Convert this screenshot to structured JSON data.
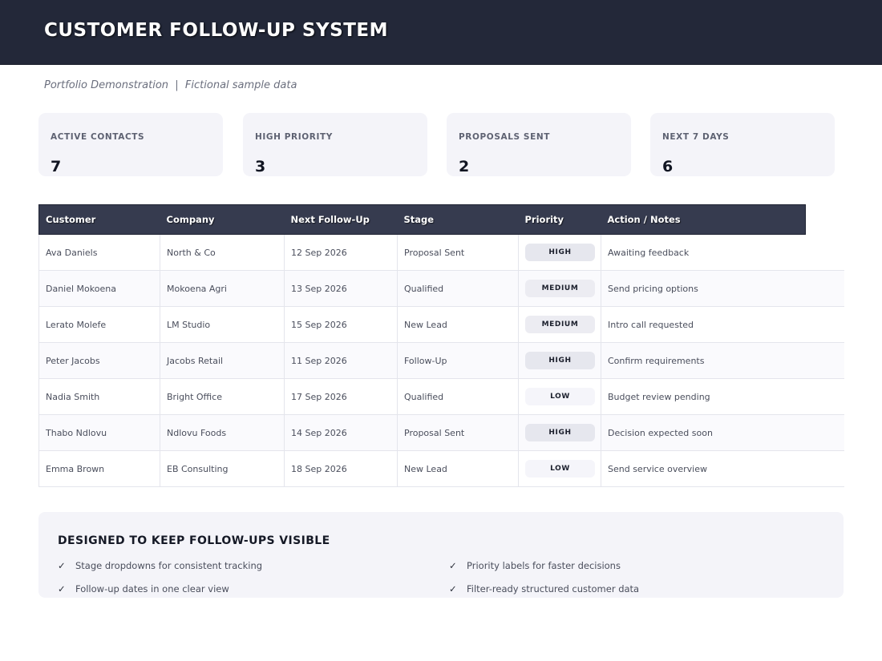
{
  "header": {
    "title": "CUSTOMER FOLLOW-UP SYSTEM"
  },
  "subtitle": "Portfolio Demonstration  |  Fictional sample data",
  "kpis": [
    {
      "label": "ACTIVE CONTACTS",
      "value": "7"
    },
    {
      "label": "HIGH PRIORITY",
      "value": "3"
    },
    {
      "label": "PROPOSALS SENT",
      "value": "2"
    },
    {
      "label": "NEXT 7 DAYS",
      "value": "6"
    }
  ],
  "table": {
    "columns": [
      "Customer",
      "Company",
      "Next Follow-Up",
      "Stage",
      "Priority",
      "Action / Notes"
    ],
    "rows": [
      [
        "Ava Daniels",
        "North & Co",
        "12 Sep 2026",
        "Proposal Sent",
        "HIGH",
        "Awaiting feedback"
      ],
      [
        "Daniel Mokoena",
        "Mokoena Agri",
        "13 Sep 2026",
        "Qualified",
        "MEDIUM",
        "Send pricing options"
      ],
      [
        "Lerato Molefe",
        "LM Studio",
        "15 Sep 2026",
        "New Lead",
        "MEDIUM",
        "Intro call requested"
      ],
      [
        "Peter Jacobs",
        "Jacobs Retail",
        "11 Sep 2026",
        "Follow-Up",
        "HIGH",
        "Confirm requirements"
      ],
      [
        "Nadia Smith",
        "Bright Office",
        "17 Sep 2026",
        "Qualified",
        "LOW",
        "Budget review pending"
      ],
      [
        "Thabo Ndlovu",
        "Ndlovu Foods",
        "14 Sep 2026",
        "Proposal Sent",
        "HIGH",
        "Decision expected soon"
      ],
      [
        "Emma Brown",
        "EB Consulting",
        "18 Sep 2026",
        "New Lead",
        "LOW",
        "Send service overview"
      ]
    ]
  },
  "features": {
    "title": "DESIGNED TO KEEP FOLLOW-UPS VISIBLE",
    "check_icon": "✓",
    "items": [
      "Stage dropdowns for consistent tracking",
      "Priority labels for faster decisions",
      "Follow-up dates in one clear view",
      "Filter-ready structured customer data"
    ]
  },
  "icons": {
    "check": "checkmark-icon"
  },
  "colors": {
    "header_bg": "#232839",
    "table_header_bg": "#363b4f",
    "card_bg": "#f4f4f9"
  }
}
